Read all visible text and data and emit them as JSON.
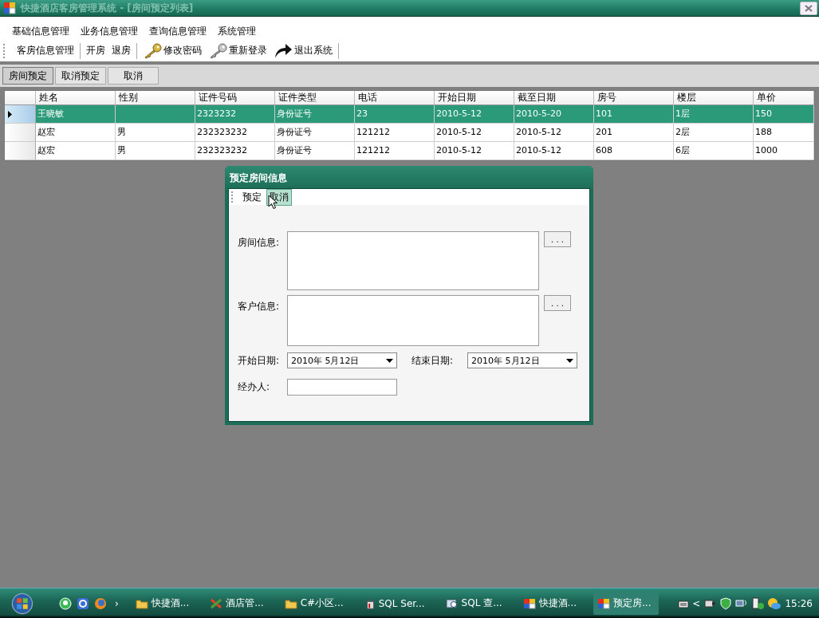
{
  "window": {
    "title": "快捷酒店客房管理系统 - [房间预定列表]"
  },
  "menu": [
    "基础信息管理",
    "业务信息管理",
    "查询信息管理",
    "系统管理"
  ],
  "toolbar": [
    {
      "items": [
        {
          "label": "客房信息管理",
          "kind": "text"
        }
      ]
    },
    {
      "items": [
        {
          "label": "开房",
          "kind": "text"
        },
        {
          "label": "退房",
          "kind": "text"
        }
      ]
    },
    {
      "items": [
        {
          "label": "修改密码",
          "kind": "gold-key"
        },
        {
          "label": "重新登录",
          "kind": "silver-key"
        },
        {
          "label": "退出系统",
          "kind": "arrow"
        }
      ]
    }
  ],
  "buttons": [
    {
      "label": "房间预定",
      "selected": true
    },
    {
      "label": "取消预定",
      "selected": false
    },
    {
      "label": "取消",
      "selected": false
    }
  ],
  "table": {
    "columns": [
      "姓名",
      "性别",
      "证件号码",
      "证件类型",
      "电话",
      "开始日期",
      "截至日期",
      "房号",
      "楼层",
      "单价"
    ],
    "rows": [
      {
        "selected": true,
        "cells": [
          "王晓敏",
          "",
          "2323232",
          "身份证号",
          "23",
          "2010-5-12",
          "2010-5-20",
          "101",
          "1层",
          "150"
        ]
      },
      {
        "selected": false,
        "cells": [
          "赵宏",
          "男",
          "232323232",
          "身份证号",
          "121212",
          "2010-5-12",
          "2010-5-12",
          "201",
          "2层",
          "188"
        ]
      },
      {
        "selected": false,
        "cells": [
          "赵宏",
          "男",
          "232323232",
          "身份证号",
          "121212",
          "2010-5-12",
          "2010-5-12",
          "608",
          "6层",
          "1000"
        ]
      }
    ]
  },
  "dialog": {
    "title": "预定房间信息",
    "toolbar": [
      {
        "label": "预定",
        "hovered": false
      },
      {
        "label": "取消",
        "hovered": true
      }
    ],
    "fields": [
      {
        "kind": "textarea",
        "label": "房间信息:",
        "button": ". . ."
      },
      {
        "kind": "textarea",
        "label": "客户信息:",
        "button": ". . ."
      },
      {
        "kind": "dates",
        "items": [
          {
            "label": "开始日期:",
            "value": "2010年  5月12日"
          },
          {
            "label": "结束日期:",
            "value": "2010年  5月12日"
          }
        ]
      },
      {
        "kind": "text",
        "label": "经办人:"
      }
    ]
  },
  "taskbar": {
    "more": "›",
    "tasks": [
      {
        "label": "快捷酒...",
        "kind": "folder",
        "selected": false
      },
      {
        "label": "酒店管...",
        "kind": "tools",
        "selected": false
      },
      {
        "label": "C#小区...",
        "kind": "folder",
        "selected": false
      },
      {
        "label": "SQL Ser...",
        "kind": "server",
        "selected": false
      },
      {
        "label": "SQL 查...",
        "kind": "query",
        "selected": false
      },
      {
        "label": "快捷酒...",
        "kind": "app",
        "selected": false
      },
      {
        "label": "预定房...",
        "kind": "app",
        "selected": true
      }
    ],
    "tray_toggle": "<",
    "clock": "15:26"
  }
}
